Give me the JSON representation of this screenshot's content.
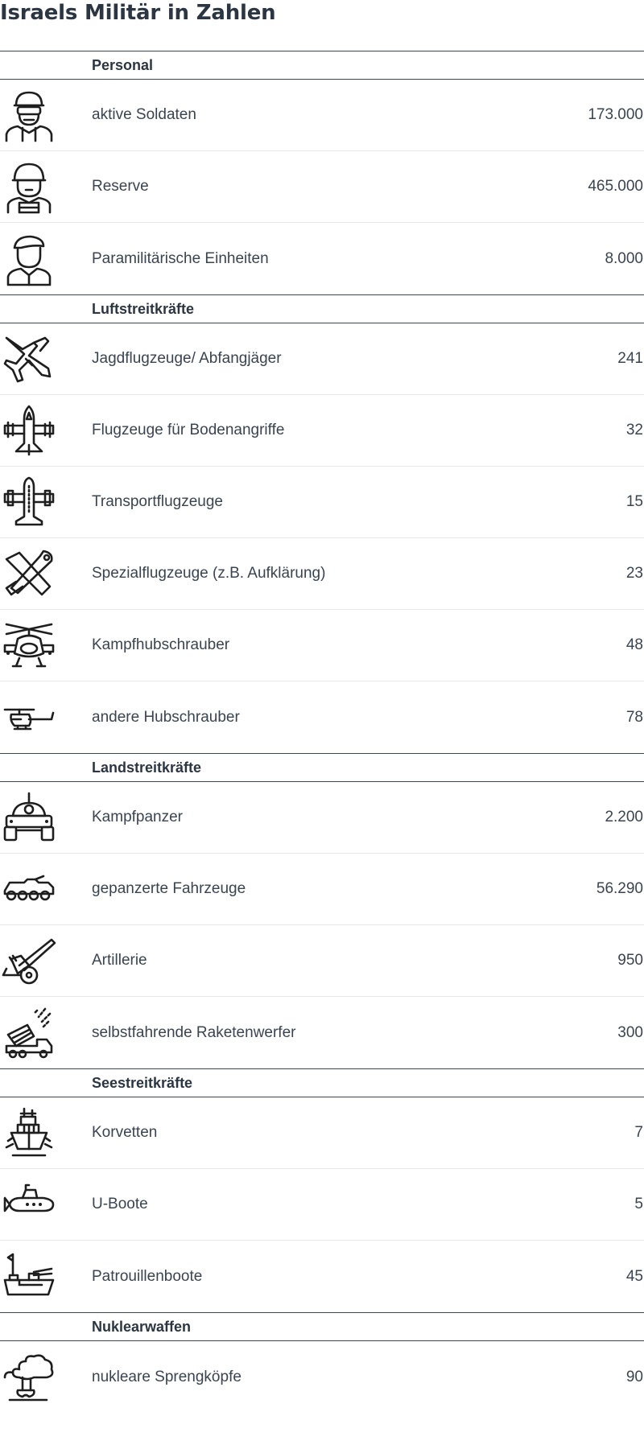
{
  "title": "Israels Militär in Zahlen",
  "sections": [
    {
      "label": "Personal",
      "rows": [
        {
          "icon": "soldier-goggles-icon",
          "label": "aktive Soldaten",
          "value": "173.000"
        },
        {
          "icon": "soldier-helmet-icon",
          "label": "Reserve",
          "value": "465.000"
        },
        {
          "icon": "soldier-beret-icon",
          "label": "Paramilitärische Einheiten",
          "value": "8.000"
        }
      ]
    },
    {
      "label": "Luftstreitkräfte",
      "rows": [
        {
          "icon": "fighter-jet-icon",
          "label": "Jagdflugzeuge/ Abfangjäger",
          "value": "241"
        },
        {
          "icon": "attack-aircraft-icon",
          "label": "Flugzeuge für Bodenangriffe",
          "value": "32"
        },
        {
          "icon": "transport-aircraft-icon",
          "label": "Transportflugzeuge",
          "value": "15"
        },
        {
          "icon": "drone-icon",
          "label": "Spezialflugzeuge (z.B. Aufklärung)",
          "value": "23"
        },
        {
          "icon": "attack-helicopter-icon",
          "label": "Kampfhubschrauber",
          "value": "48"
        },
        {
          "icon": "helicopter-icon",
          "label": "andere Hubschrauber",
          "value": "78"
        }
      ]
    },
    {
      "label": "Landstreitkräfte",
      "rows": [
        {
          "icon": "tank-icon",
          "label": "Kampfpanzer",
          "value": "2.200"
        },
        {
          "icon": "armored-vehicle-icon",
          "label": "gepanzerte Fahrzeuge",
          "value": "56.290"
        },
        {
          "icon": "artillery-icon",
          "label": "Artillerie",
          "value": "950"
        },
        {
          "icon": "rocket-launcher-icon",
          "label": "selbstfahrende Raketenwerfer",
          "value": "300"
        }
      ]
    },
    {
      "label": "Seestreitkräfte",
      "rows": [
        {
          "icon": "corvette-icon",
          "label": "Korvetten",
          "value": "7"
        },
        {
          "icon": "submarine-icon",
          "label": "U-Boote",
          "value": "5"
        },
        {
          "icon": "patrol-boat-icon",
          "label": "Patrouillenboote",
          "value": "45"
        }
      ]
    },
    {
      "label": "Nuklearwaffen",
      "rows": [
        {
          "icon": "mushroom-cloud-icon",
          "label": "nukleare Sprengköpfe",
          "value": "90"
        }
      ]
    }
  ]
}
